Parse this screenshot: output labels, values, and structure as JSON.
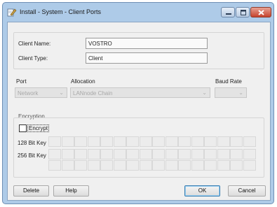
{
  "window": {
    "title": "Install - System - Client Ports",
    "title_icon": "install-wrench-icon",
    "controls": {
      "minimize": "minimize-icon",
      "maximize": "maximize-icon",
      "close": "close-icon"
    }
  },
  "client": {
    "name_label": "Client Name:",
    "name_value": "VOSTRO",
    "type_label": "Client Type:",
    "type_value": "Client"
  },
  "port": {
    "port_label": "Port",
    "port_value": "Network",
    "allocation_label": "Allocation",
    "allocation_value": "LANnode Chain",
    "baud_label": "Baud Rate",
    "baud_value": ""
  },
  "encryption": {
    "group_label": "Encryption",
    "checkbox_label": "Encrypt",
    "checked": false,
    "key128_label": "128 Bit Key",
    "key256_label": "256 Bit Key"
  },
  "buttons": {
    "delete": "Delete",
    "help": "Help",
    "ok": "OK",
    "cancel": "Cancel"
  },
  "colors": {
    "window_frame": "#aecbe8",
    "client_bg": "#f0f0f0",
    "close_button": "#c6432d",
    "ok_border": "#3c7fb1"
  }
}
